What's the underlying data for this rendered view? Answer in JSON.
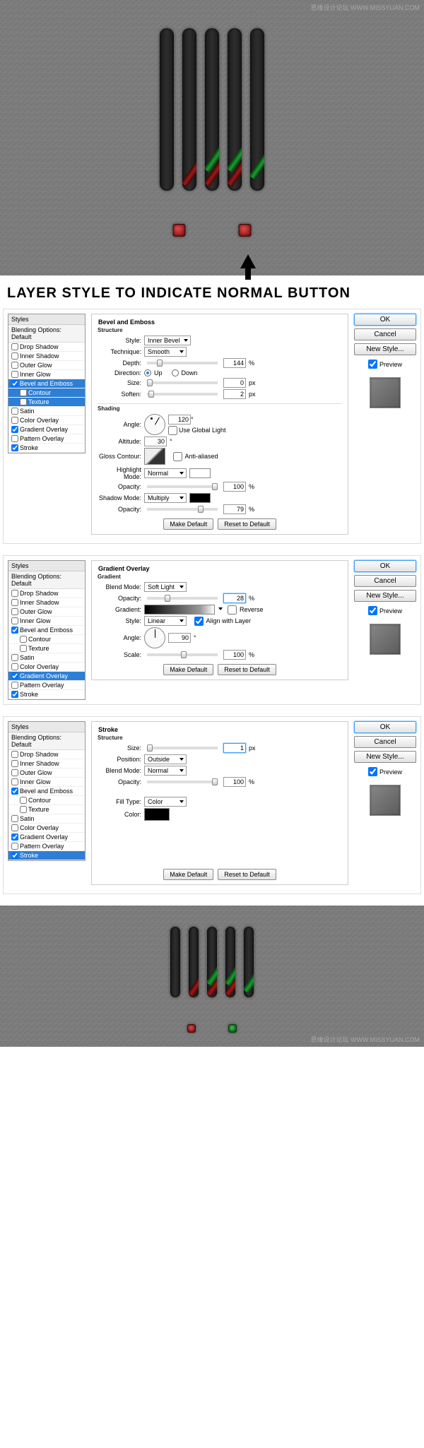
{
  "watermark": "思缘设计论坛 WWW.MISSYUAN.COM",
  "heading": "LAYER STYLE TO INDICATE NORMAL BUTTON",
  "common": {
    "styles_header": "Styles",
    "blending_options": "Blending Options: Default",
    "ok": "OK",
    "cancel": "Cancel",
    "new_style": "New Style...",
    "preview": "Preview",
    "make_default": "Make Default",
    "reset_default": "Reset to Default"
  },
  "styles_list": [
    {
      "label": "Drop Shadow"
    },
    {
      "label": "Inner Shadow"
    },
    {
      "label": "Outer Glow"
    },
    {
      "label": "Inner Glow"
    },
    {
      "label": "Bevel and Emboss",
      "checked": true
    },
    {
      "label": "Contour",
      "indent": true
    },
    {
      "label": "Texture",
      "indent": true
    },
    {
      "label": "Satin"
    },
    {
      "label": "Color Overlay"
    },
    {
      "label": "Gradient Overlay",
      "checked": true
    },
    {
      "label": "Pattern Overlay"
    },
    {
      "label": "Stroke",
      "checked": true
    }
  ],
  "bevel": {
    "title": "Bevel and Emboss",
    "structure": "Structure",
    "style_label": "Style:",
    "style_value": "Inner Bevel",
    "technique_label": "Technique:",
    "technique_value": "Smooth",
    "depth_label": "Depth:",
    "depth_value": "144",
    "percent": "%",
    "direction_label": "Direction:",
    "up": "Up",
    "down": "Down",
    "size_label": "Size:",
    "size_value": "0",
    "px": "px",
    "soften_label": "Soften:",
    "soften_value": "2",
    "shading": "Shading",
    "angle_label": "Angle:",
    "angle_value": "120",
    "deg": "°",
    "use_global": "Use Global Light",
    "altitude_label": "Altitude:",
    "altitude_value": "30",
    "gloss_label": "Gloss Contour:",
    "anti": "Anti-aliased",
    "highlight_label": "Highlight Mode:",
    "highlight_value": "Normal",
    "opacity_label": "Opacity:",
    "hl_opacity": "100",
    "shadow_label": "Shadow Mode:",
    "shadow_value": "Multiply",
    "sh_opacity": "79",
    "hl_color": "#ffffff",
    "sh_color": "#000000"
  },
  "gradient": {
    "title": "Gradient Overlay",
    "sub": "Gradient",
    "blend_label": "Blend Mode:",
    "blend_value": "Soft Light",
    "opacity_label": "Opacity:",
    "opacity_value": "28",
    "percent": "%",
    "gradient_label": "Gradient:",
    "reverse": "Reverse",
    "style_label": "Style:",
    "style_value": "Linear",
    "align": "Align with Layer",
    "angle_label": "Angle:",
    "angle_value": "90",
    "deg": "°",
    "scale_label": "Scale:",
    "scale_value": "100"
  },
  "stroke": {
    "title": "Stroke",
    "structure": "Structure",
    "size_label": "Size:",
    "size_value": "1",
    "px": "px",
    "position_label": "Position:",
    "position_value": "Outside",
    "blend_label": "Blend Mode:",
    "blend_value": "Normal",
    "opacity_label": "Opacity:",
    "opacity_value": "100",
    "percent": "%",
    "fill_label": "Fill Type:",
    "fill_value": "Color",
    "color_label": "Color:",
    "color_value": "#000000"
  }
}
